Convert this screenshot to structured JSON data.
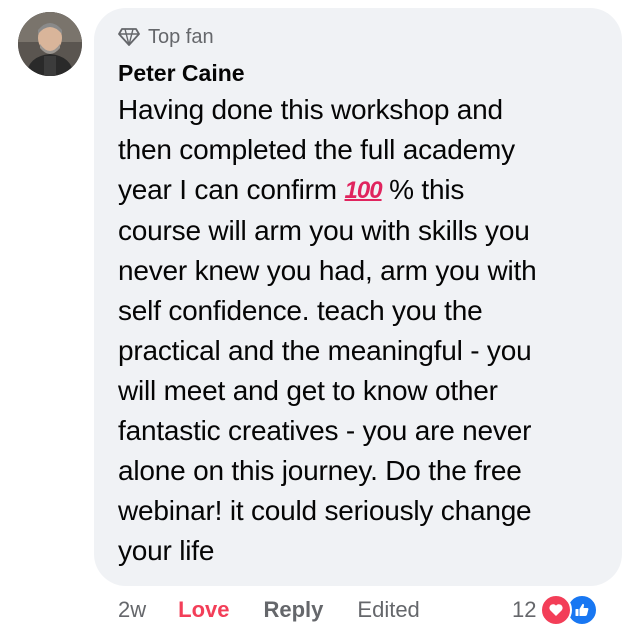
{
  "comment": {
    "badge_label": "Top fan",
    "author": "Peter Caine",
    "text_part1": "Having done this workshop and\nthen completed the full academy\nyear I can confirm ",
    "emoji_hundred": "100",
    "text_part2": " % this\ncourse will arm you with skills you\nnever knew you had, arm you with\nself confidence. teach you the\npractical and the meaningful - you\nwill meet and get to know other\nfantastic creatives - you are never\nalone on this journey. Do the free\nwebinar! it could seriously change\nyour life"
  },
  "actions": {
    "time": "2w",
    "love": "Love",
    "reply": "Reply",
    "edited": "Edited"
  },
  "reactions": {
    "count": "12",
    "icons": [
      "love-icon",
      "like-icon"
    ]
  },
  "colors": {
    "bubble_bg": "#f0f2f5",
    "love_red": "#f33e58",
    "like_blue": "#1877f2",
    "meta_gray": "#65676b"
  }
}
